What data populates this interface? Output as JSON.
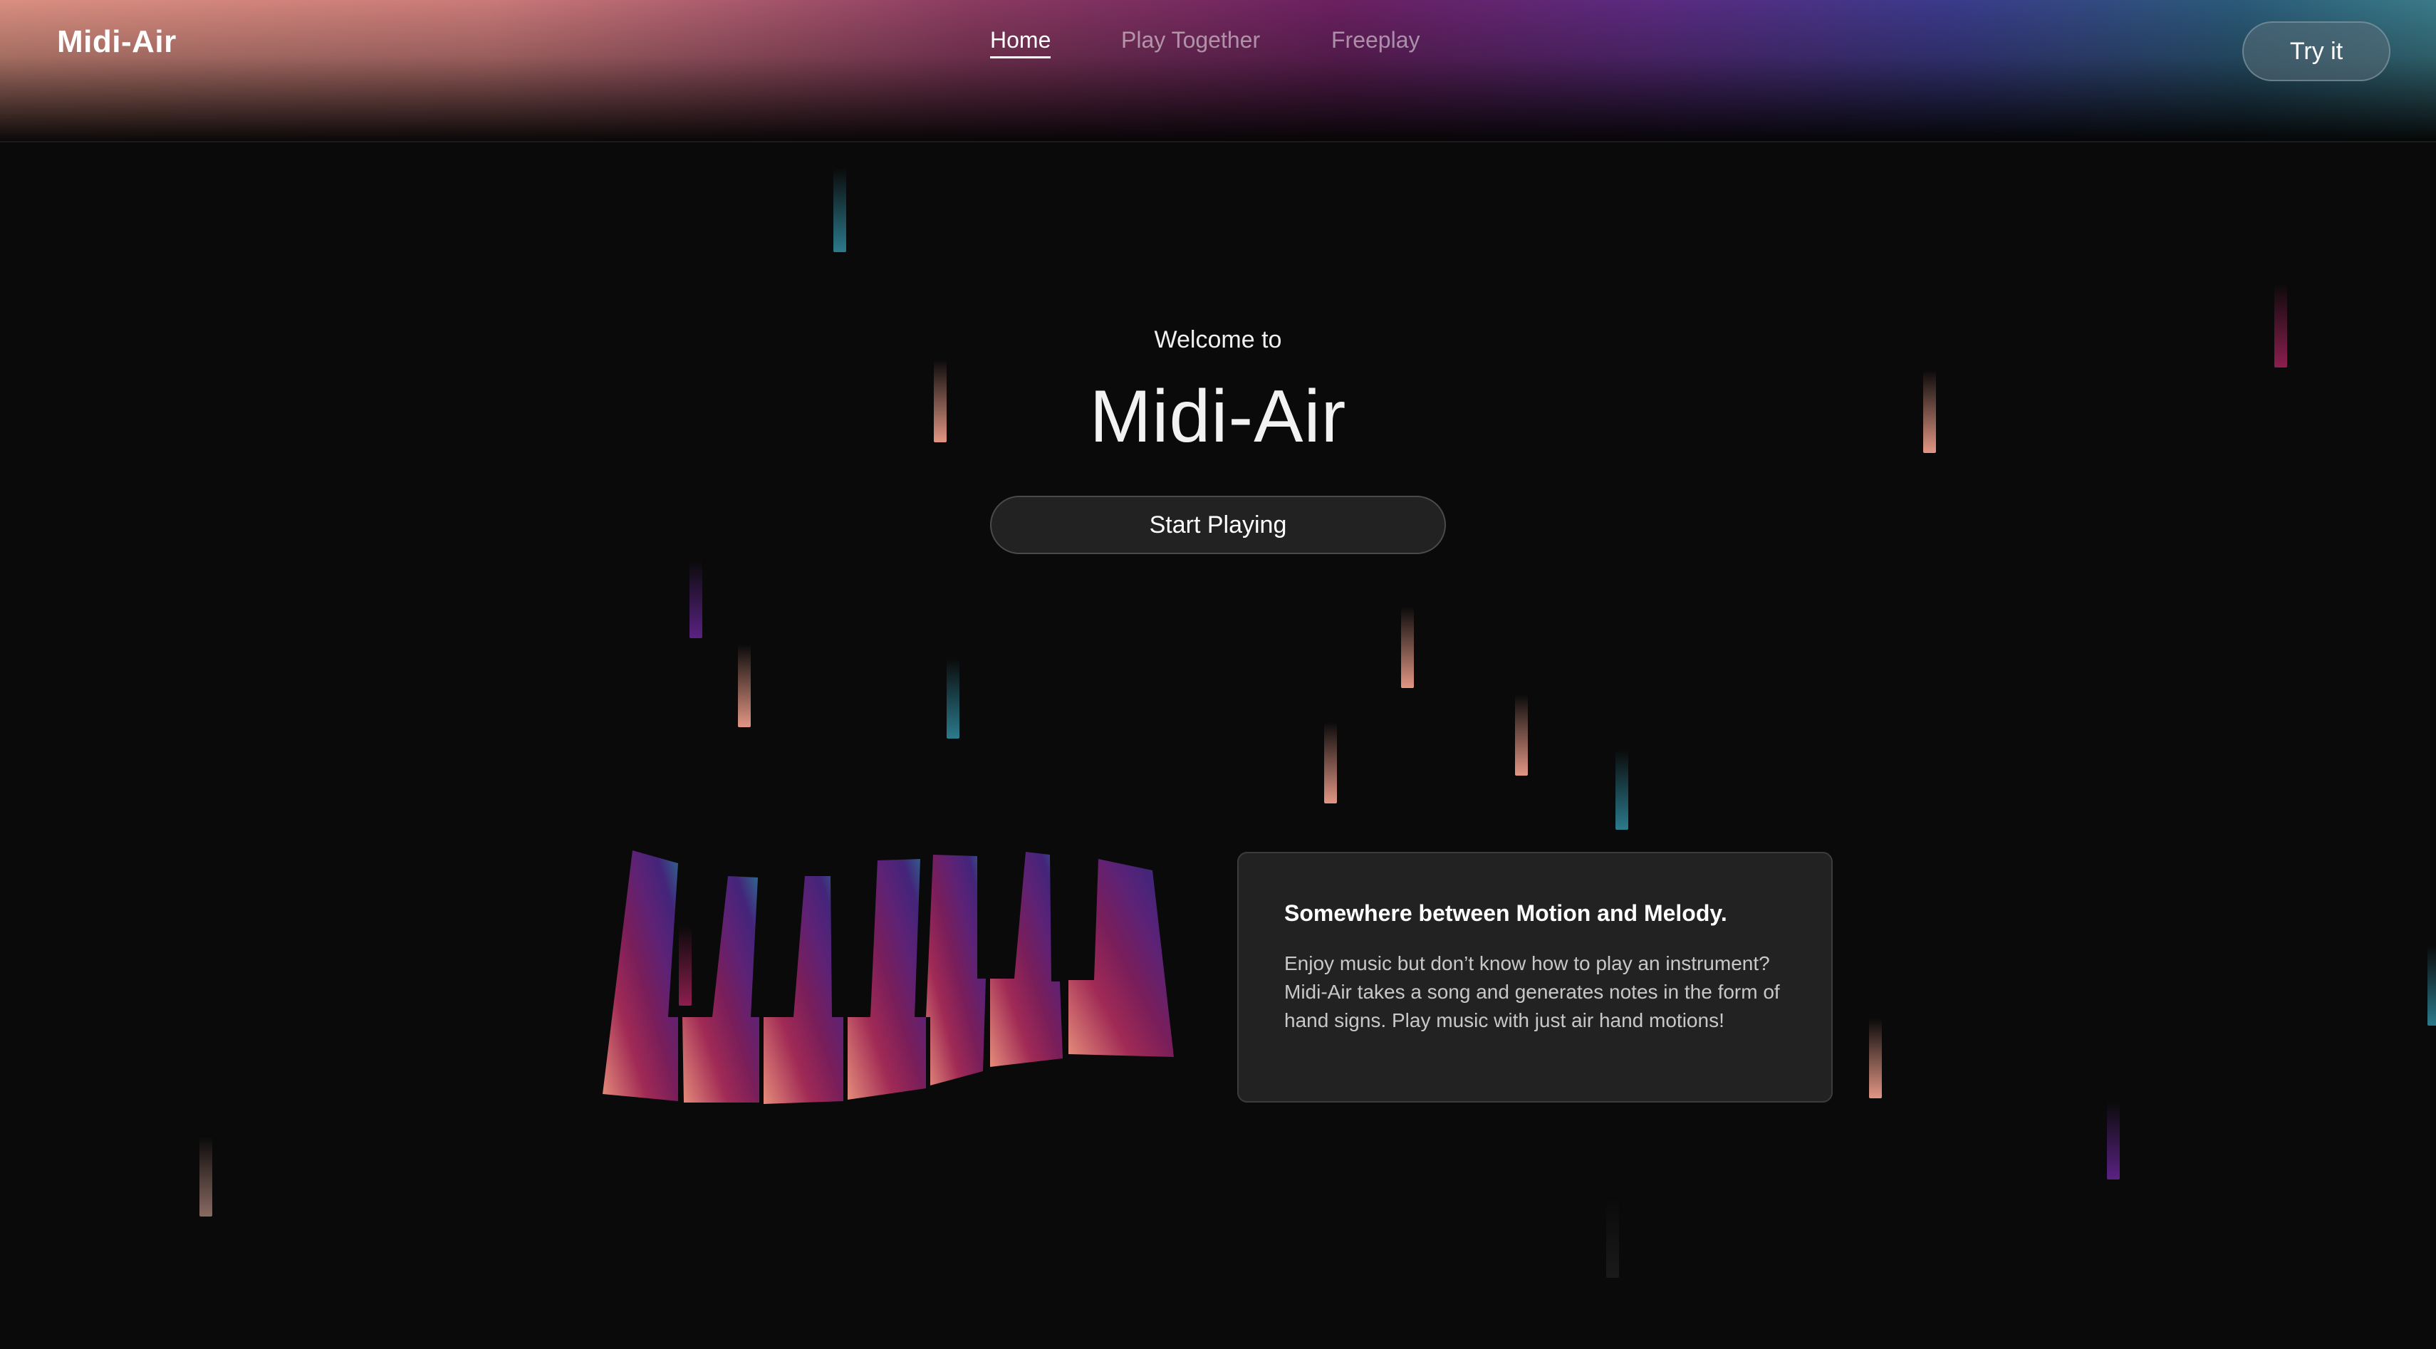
{
  "header": {
    "logo": "Midi-Air",
    "nav": {
      "home": "Home",
      "play_together": "Play Together",
      "freeplay": "Freeplay",
      "active": "Home"
    },
    "cta_label": "Try it"
  },
  "hero": {
    "welcome": "Welcome to",
    "title": "Midi-Air",
    "start_button": "Start Playing"
  },
  "feature_card": {
    "title": "Somewhere between Motion and Melody.",
    "body": "Enjoy music but don’t know how to play an instrument? Midi-Air takes a song and generates notes in the form of hand signs. Play music with just air hand motions!"
  },
  "colors": {
    "background": "#0a0a0a",
    "accent_peach": "#e29684",
    "accent_pink": "#8c1e4e",
    "accent_purple": "#5a2282",
    "accent_teal": "#2b7a8c",
    "card": "#222222"
  },
  "icons": {
    "piano": "curved-piano-keyboard-graphic"
  }
}
